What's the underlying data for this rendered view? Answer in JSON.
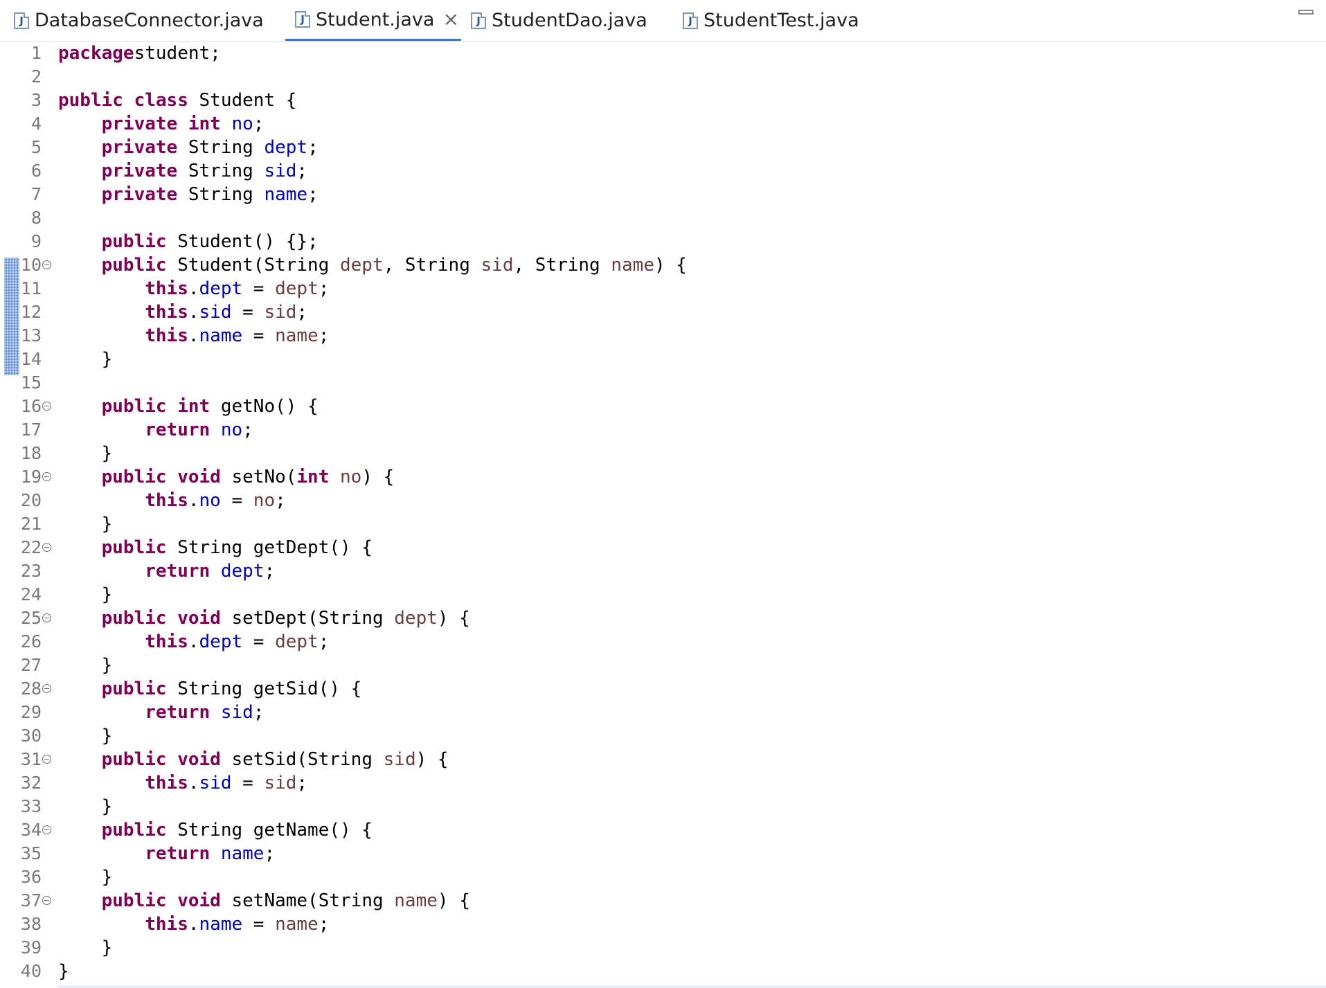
{
  "tabs": [
    {
      "label": "DatabaseConnector.java",
      "icon": "java-file-icon",
      "active": false
    },
    {
      "label": "Student.java",
      "icon": "java-file-icon",
      "active": true,
      "close": "×"
    },
    {
      "label": "StudentDao.java",
      "icon": "java-file-icon",
      "active": false
    },
    {
      "label": "StudentTest.java",
      "icon": "java-file-icon",
      "active": false
    }
  ],
  "icon_glyph": "J",
  "colors": {
    "keyword": "#7f0055",
    "field": "#0000c0",
    "parameter": "#6a3e3e",
    "line_number": "#7a7a7a",
    "change_marker": "#5d8dd2",
    "active_tab": "#3a77c9"
  },
  "editor": {
    "changed_lines": [
      10,
      14
    ],
    "foldable_lines": [
      10,
      16,
      19,
      22,
      25,
      28,
      31,
      34,
      37
    ],
    "lines": [
      {
        "n": "1",
        "tokens": [
          [
            "kw",
            "package"
          ],
          [
            "",
            "student;"
          ]
        ]
      },
      {
        "n": "2",
        "tokens": []
      },
      {
        "n": "3",
        "tokens": [
          [
            "kw",
            "public"
          ],
          [
            "",
            " "
          ],
          [
            "kw",
            "class"
          ],
          [
            "",
            " Student {"
          ]
        ]
      },
      {
        "n": "4",
        "tokens": [
          [
            "",
            "    "
          ],
          [
            "kw",
            "private"
          ],
          [
            "",
            " "
          ],
          [
            "kw",
            "int"
          ],
          [
            "",
            " "
          ],
          [
            "fld",
            "no"
          ],
          [
            "",
            ";"
          ]
        ]
      },
      {
        "n": "5",
        "tokens": [
          [
            "",
            "    "
          ],
          [
            "kw",
            "private"
          ],
          [
            "",
            " String "
          ],
          [
            "fld",
            "dept"
          ],
          [
            "",
            ";"
          ]
        ]
      },
      {
        "n": "6",
        "tokens": [
          [
            "",
            "    "
          ],
          [
            "kw",
            "private"
          ],
          [
            "",
            " String "
          ],
          [
            "fld",
            "sid"
          ],
          [
            "",
            ";"
          ]
        ]
      },
      {
        "n": "7",
        "tokens": [
          [
            "",
            "    "
          ],
          [
            "kw",
            "private"
          ],
          [
            "",
            " String "
          ],
          [
            "fld",
            "name"
          ],
          [
            "",
            ";"
          ]
        ]
      },
      {
        "n": "8",
        "tokens": []
      },
      {
        "n": "9",
        "tokens": [
          [
            "",
            "    "
          ],
          [
            "kw",
            "public"
          ],
          [
            "",
            " Student() {};"
          ]
        ]
      },
      {
        "n": "10",
        "tokens": [
          [
            "",
            "    "
          ],
          [
            "kw",
            "public"
          ],
          [
            "",
            " Student(String "
          ],
          [
            "prm",
            "dept"
          ],
          [
            "",
            ", String "
          ],
          [
            "prm",
            "sid"
          ],
          [
            "",
            ", String "
          ],
          [
            "prm",
            "name"
          ],
          [
            "",
            ") {"
          ]
        ]
      },
      {
        "n": "11",
        "tokens": [
          [
            "",
            "        "
          ],
          [
            "kw",
            "this"
          ],
          [
            "",
            "."
          ],
          [
            "fld",
            "dept"
          ],
          [
            "",
            " = "
          ],
          [
            "prm",
            "dept"
          ],
          [
            "",
            ";"
          ]
        ]
      },
      {
        "n": "12",
        "tokens": [
          [
            "",
            "        "
          ],
          [
            "kw",
            "this"
          ],
          [
            "",
            "."
          ],
          [
            "fld",
            "sid"
          ],
          [
            "",
            " = "
          ],
          [
            "prm",
            "sid"
          ],
          [
            "",
            ";"
          ]
        ]
      },
      {
        "n": "13",
        "tokens": [
          [
            "",
            "        "
          ],
          [
            "kw",
            "this"
          ],
          [
            "",
            "."
          ],
          [
            "fld",
            "name"
          ],
          [
            "",
            " = "
          ],
          [
            "prm",
            "name"
          ],
          [
            "",
            ";"
          ]
        ]
      },
      {
        "n": "14",
        "tokens": [
          [
            "",
            "    }"
          ]
        ]
      },
      {
        "n": "15",
        "tokens": []
      },
      {
        "n": "16",
        "tokens": [
          [
            "",
            "    "
          ],
          [
            "kw",
            "public"
          ],
          [
            "",
            " "
          ],
          [
            "kw",
            "int"
          ],
          [
            "",
            " getNo() {"
          ]
        ]
      },
      {
        "n": "17",
        "tokens": [
          [
            "",
            "        "
          ],
          [
            "kw",
            "return"
          ],
          [
            "",
            " "
          ],
          [
            "fld",
            "no"
          ],
          [
            "",
            ";"
          ]
        ]
      },
      {
        "n": "18",
        "tokens": [
          [
            "",
            "    }"
          ]
        ]
      },
      {
        "n": "19",
        "tokens": [
          [
            "",
            "    "
          ],
          [
            "kw",
            "public"
          ],
          [
            "",
            " "
          ],
          [
            "kw",
            "void"
          ],
          [
            "",
            " setNo("
          ],
          [
            "kw",
            "int"
          ],
          [
            "",
            " "
          ],
          [
            "prm",
            "no"
          ],
          [
            "",
            ") {"
          ]
        ]
      },
      {
        "n": "20",
        "tokens": [
          [
            "",
            "        "
          ],
          [
            "kw",
            "this"
          ],
          [
            "",
            "."
          ],
          [
            "fld",
            "no"
          ],
          [
            "",
            " = "
          ],
          [
            "prm",
            "no"
          ],
          [
            "",
            ";"
          ]
        ]
      },
      {
        "n": "21",
        "tokens": [
          [
            "",
            "    }"
          ]
        ]
      },
      {
        "n": "22",
        "tokens": [
          [
            "",
            "    "
          ],
          [
            "kw",
            "public"
          ],
          [
            "",
            " String getDept() {"
          ]
        ]
      },
      {
        "n": "23",
        "tokens": [
          [
            "",
            "        "
          ],
          [
            "kw",
            "return"
          ],
          [
            "",
            " "
          ],
          [
            "fld",
            "dept"
          ],
          [
            "",
            ";"
          ]
        ]
      },
      {
        "n": "24",
        "tokens": [
          [
            "",
            "    }"
          ]
        ]
      },
      {
        "n": "25",
        "tokens": [
          [
            "",
            "    "
          ],
          [
            "kw",
            "public"
          ],
          [
            "",
            " "
          ],
          [
            "kw",
            "void"
          ],
          [
            "",
            " setDept(String "
          ],
          [
            "prm",
            "dept"
          ],
          [
            "",
            ") {"
          ]
        ]
      },
      {
        "n": "26",
        "tokens": [
          [
            "",
            "        "
          ],
          [
            "kw",
            "this"
          ],
          [
            "",
            "."
          ],
          [
            "fld",
            "dept"
          ],
          [
            "",
            " = "
          ],
          [
            "prm",
            "dept"
          ],
          [
            "",
            ";"
          ]
        ]
      },
      {
        "n": "27",
        "tokens": [
          [
            "",
            "    }"
          ]
        ]
      },
      {
        "n": "28",
        "tokens": [
          [
            "",
            "    "
          ],
          [
            "kw",
            "public"
          ],
          [
            "",
            " String getSid() {"
          ]
        ]
      },
      {
        "n": "29",
        "tokens": [
          [
            "",
            "        "
          ],
          [
            "kw",
            "return"
          ],
          [
            "",
            " "
          ],
          [
            "fld",
            "sid"
          ],
          [
            "",
            ";"
          ]
        ]
      },
      {
        "n": "30",
        "tokens": [
          [
            "",
            "    }"
          ]
        ]
      },
      {
        "n": "31",
        "tokens": [
          [
            "",
            "    "
          ],
          [
            "kw",
            "public"
          ],
          [
            "",
            " "
          ],
          [
            "kw",
            "void"
          ],
          [
            "",
            " setSid(String "
          ],
          [
            "prm",
            "sid"
          ],
          [
            "",
            ") {"
          ]
        ]
      },
      {
        "n": "32",
        "tokens": [
          [
            "",
            "        "
          ],
          [
            "kw",
            "this"
          ],
          [
            "",
            "."
          ],
          [
            "fld",
            "sid"
          ],
          [
            "",
            " = "
          ],
          [
            "prm",
            "sid"
          ],
          [
            "",
            ";"
          ]
        ]
      },
      {
        "n": "33",
        "tokens": [
          [
            "",
            "    }"
          ]
        ]
      },
      {
        "n": "34",
        "tokens": [
          [
            "",
            "    "
          ],
          [
            "kw",
            "public"
          ],
          [
            "",
            " String getName() {"
          ]
        ]
      },
      {
        "n": "35",
        "tokens": [
          [
            "",
            "        "
          ],
          [
            "kw",
            "return"
          ],
          [
            "",
            " "
          ],
          [
            "fld",
            "name"
          ],
          [
            "",
            ";"
          ]
        ]
      },
      {
        "n": "36",
        "tokens": [
          [
            "",
            "    }"
          ]
        ]
      },
      {
        "n": "37",
        "tokens": [
          [
            "",
            "    "
          ],
          [
            "kw",
            "public"
          ],
          [
            "",
            " "
          ],
          [
            "kw",
            "void"
          ],
          [
            "",
            " setName(String "
          ],
          [
            "prm",
            "name"
          ],
          [
            "",
            ") {"
          ]
        ]
      },
      {
        "n": "38",
        "tokens": [
          [
            "",
            "        "
          ],
          [
            "kw",
            "this"
          ],
          [
            "",
            "."
          ],
          [
            "fld",
            "name"
          ],
          [
            "",
            " = "
          ],
          [
            "prm",
            "name"
          ],
          [
            "",
            ";"
          ]
        ]
      },
      {
        "n": "39",
        "tokens": [
          [
            "",
            "    }"
          ]
        ]
      },
      {
        "n": "40",
        "tokens": [
          [
            "",
            "}"
          ]
        ]
      }
    ]
  }
}
